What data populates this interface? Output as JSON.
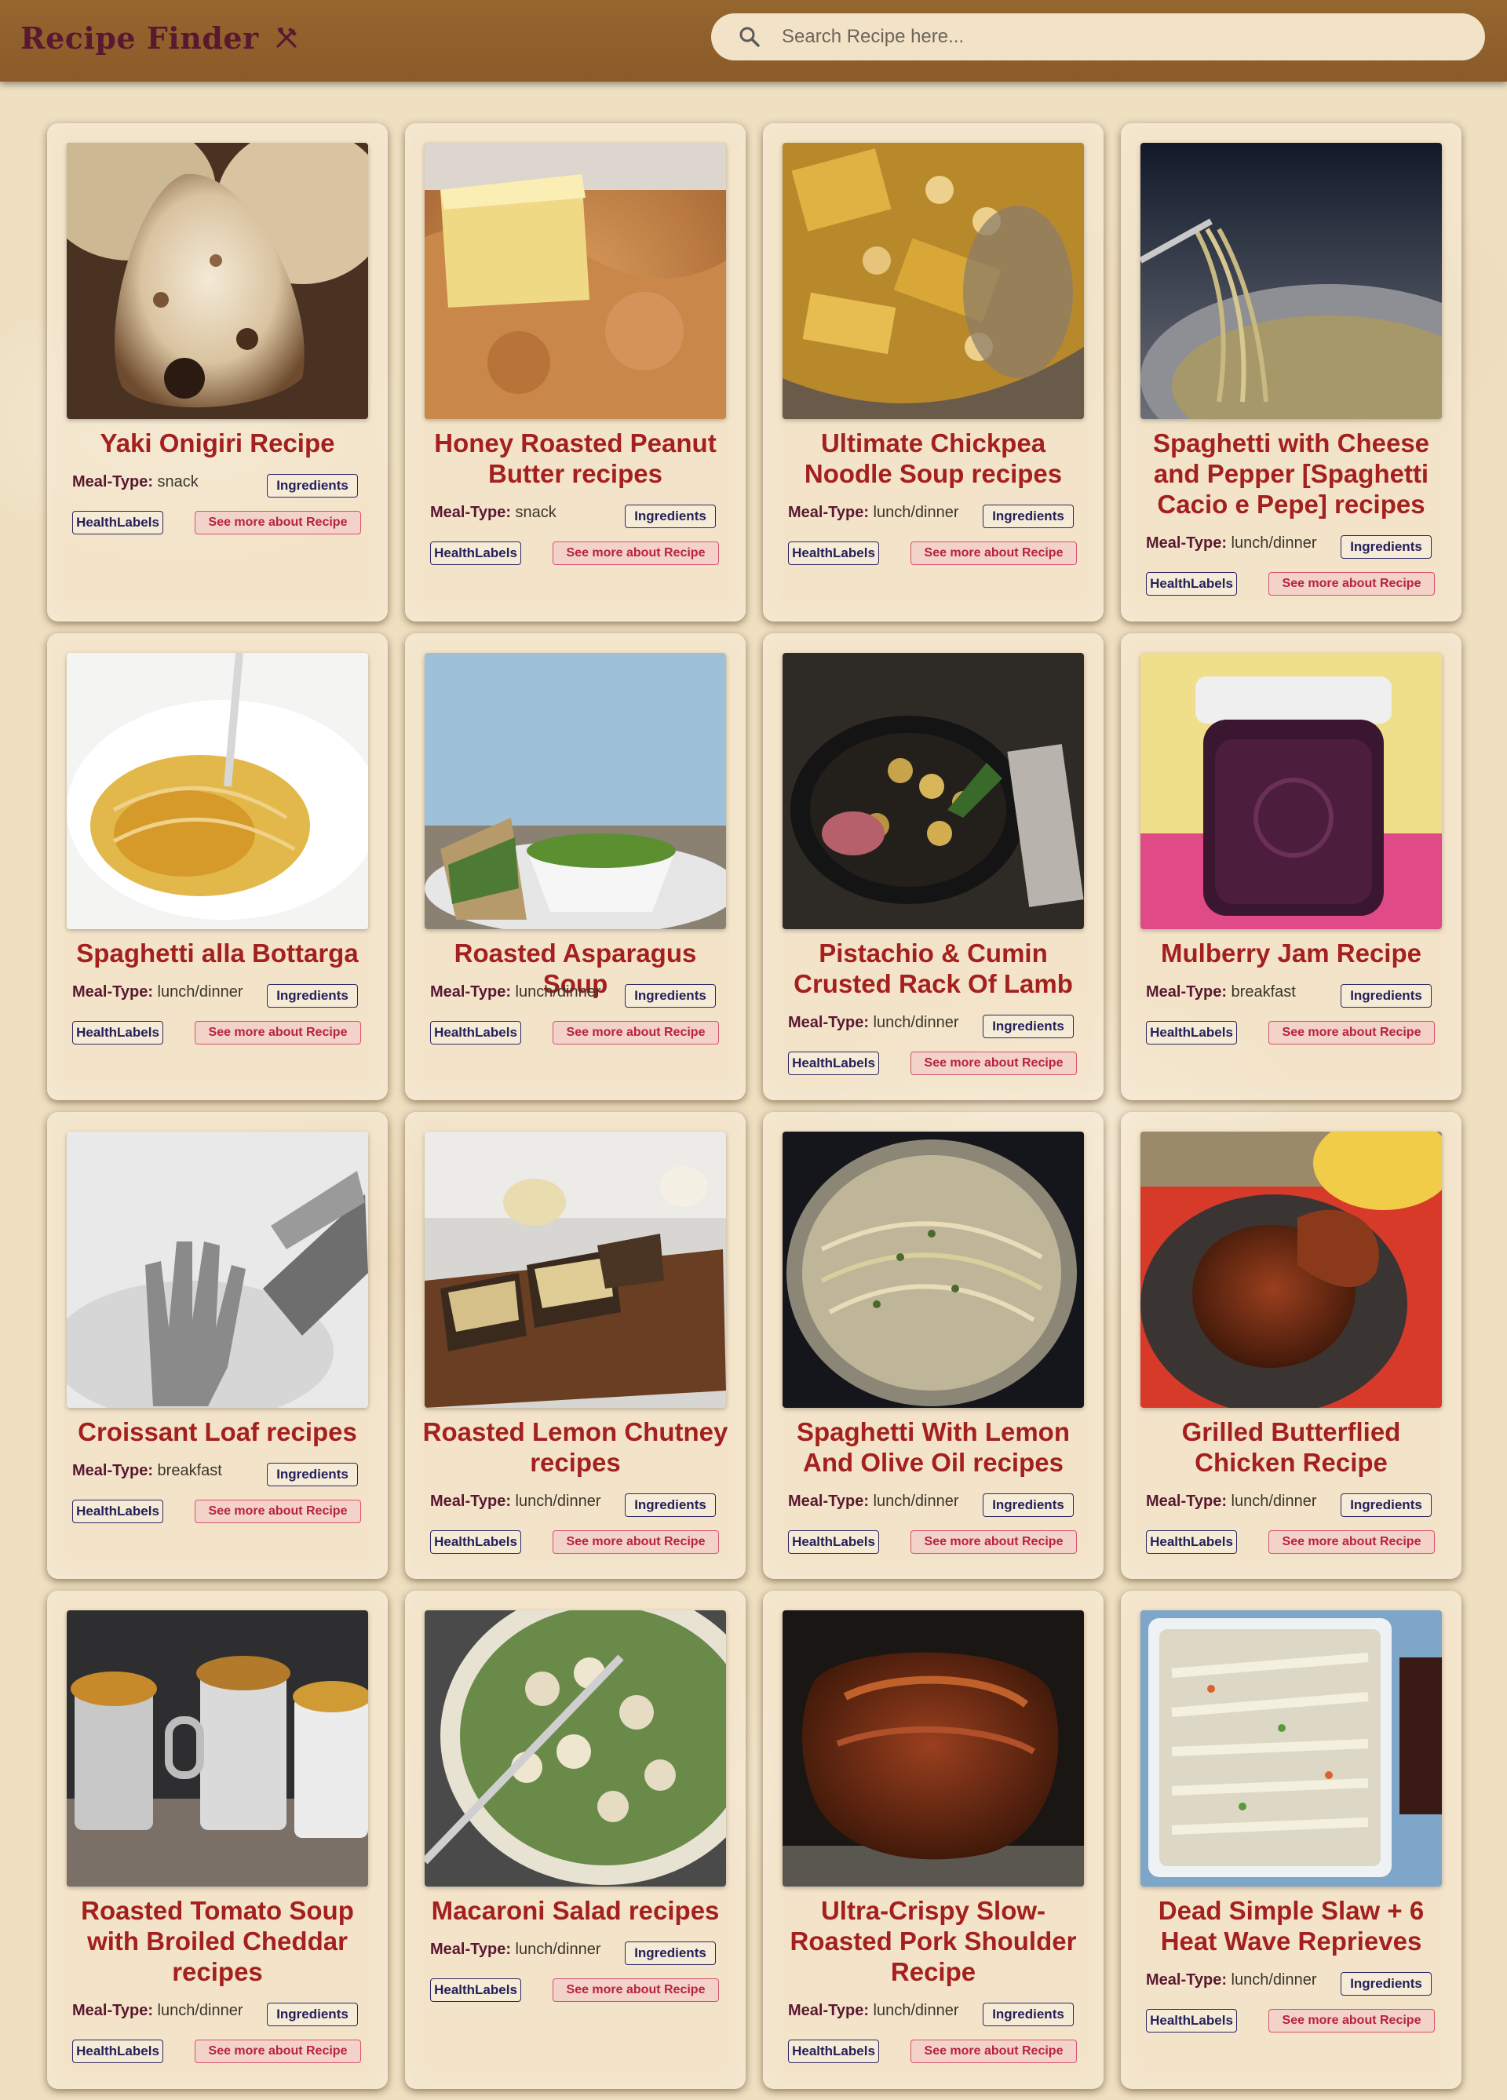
{
  "header": {
    "title": "Recipe Finder",
    "search_placeholder": "Search Recipe here..."
  },
  "labels": {
    "meal_type": "Meal-Type:",
    "ingredients": "Ingredients",
    "health_labels": "HealthLabels",
    "see_more": "See more about Recipe"
  },
  "recipes": [
    {
      "title": "Yaki Onigiri Recipe",
      "meal_type": "snack"
    },
    {
      "title": "Honey Roasted Peanut Butter recipes",
      "meal_type": "snack"
    },
    {
      "title": "Ultimate Chickpea Noodle Soup recipes",
      "meal_type": "lunch/dinner"
    },
    {
      "title": "Spaghetti with Cheese and Pepper [Spaghetti Cacio e Pepe] recipes",
      "meal_type": "lunch/dinner"
    },
    {
      "title": "Spaghetti alla Bottarga",
      "meal_type": "lunch/dinner"
    },
    {
      "title": "Roasted Asparagus Soup",
      "meal_type": "lunch/dinner"
    },
    {
      "title": "Pistachio & Cumin Crusted Rack Of Lamb",
      "meal_type": "lunch/dinner"
    },
    {
      "title": "Mulberry Jam Recipe",
      "meal_type": "breakfast"
    },
    {
      "title": "Croissant Loaf recipes",
      "meal_type": "breakfast"
    },
    {
      "title": "Roasted Lemon Chutney recipes",
      "meal_type": "lunch/dinner"
    },
    {
      "title": "Spaghetti With Lemon And Olive Oil recipes",
      "meal_type": "lunch/dinner"
    },
    {
      "title": "Grilled Butterflied Chicken Recipe",
      "meal_type": "lunch/dinner"
    },
    {
      "title": "Roasted Tomato Soup with Broiled Cheddar recipes",
      "meal_type": "lunch/dinner"
    },
    {
      "title": "Macaroni Salad recipes",
      "meal_type": "lunch/dinner"
    },
    {
      "title": "Ultra-Crispy Slow-Roasted Pork Shoulder Recipe",
      "meal_type": "lunch/dinner"
    },
    {
      "title": "Dead Simple Slaw + 6 Heat Wave Reprieves",
      "meal_type": "lunch/dinner"
    }
  ]
}
